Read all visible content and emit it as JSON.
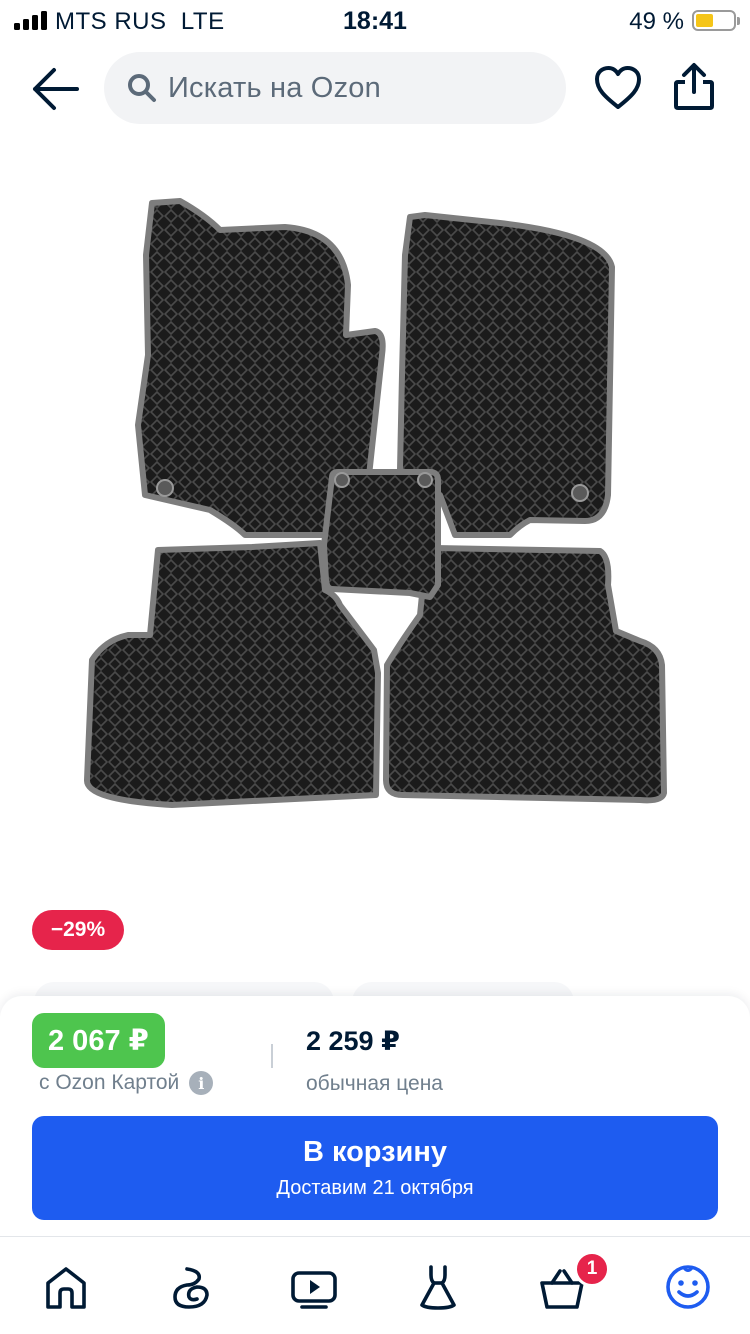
{
  "status_bar": {
    "carrier": "MTS RUS",
    "network": "LTE",
    "time": "18:41",
    "battery_percent": "49 %",
    "battery_color": "#f5c518"
  },
  "header": {
    "back_icon": "arrow-left-icon",
    "search_placeholder": "Искать на Ozon",
    "favorite_icon": "heart-icon",
    "share_icon": "share-icon"
  },
  "product": {
    "image": "car-floor-mats-set",
    "discount": "−29%"
  },
  "pricing": {
    "ozon_card_price": "2 067 ₽",
    "ozon_card_label": "с Ozon Картой",
    "regular_price": "2 259 ₽",
    "regular_label": "обычная цена",
    "accent_green": "#4ec54e"
  },
  "cart_button": {
    "title": "В корзину",
    "subtitle": "Доставим 21 октября",
    "color": "#1e5cf0"
  },
  "tab_bar": {
    "tabs": [
      {
        "name": "home",
        "icon": "home-icon"
      },
      {
        "name": "fresh",
        "icon": "swirl-icon"
      },
      {
        "name": "video",
        "icon": "video-icon"
      },
      {
        "name": "fashion",
        "icon": "dress-icon"
      },
      {
        "name": "cart",
        "icon": "basket-icon",
        "badge": "1"
      },
      {
        "name": "profile",
        "icon": "smiley-icon",
        "active": true
      }
    ],
    "active_color": "#1e5cf0"
  }
}
